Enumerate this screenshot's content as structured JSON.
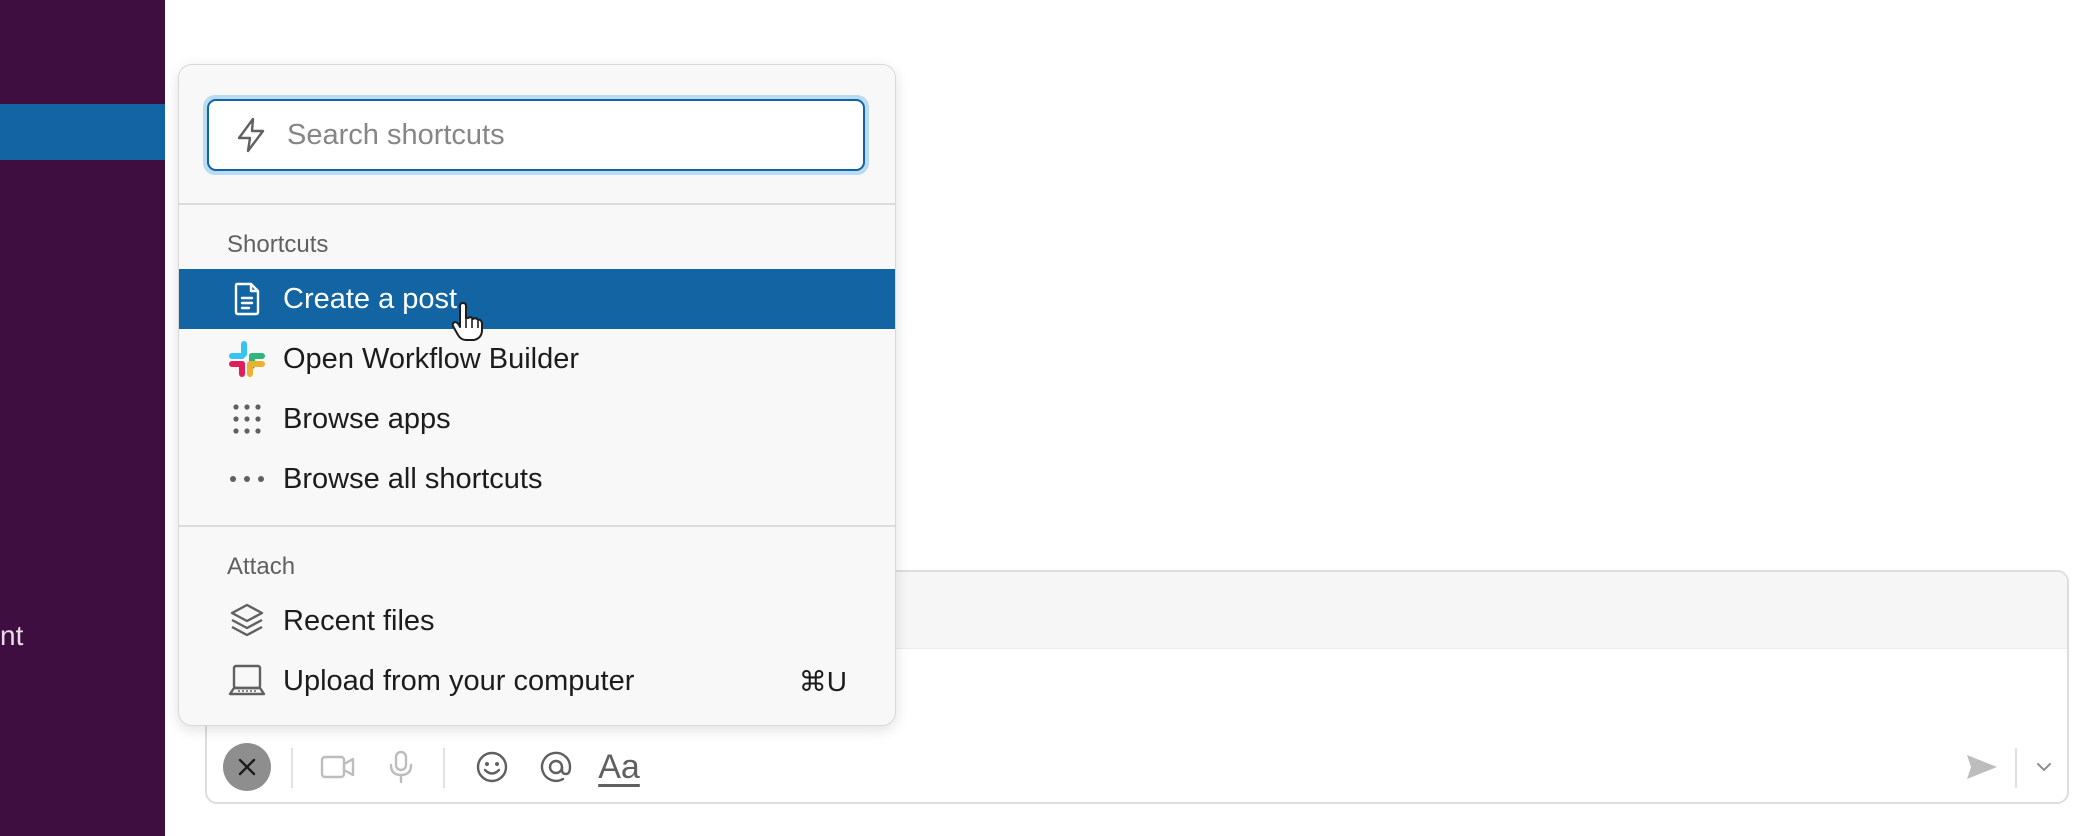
{
  "sidebar": {
    "visible_fragment": "nt"
  },
  "popup": {
    "search": {
      "placeholder": "Search shortcuts",
      "value": ""
    },
    "sections": {
      "shortcuts_label": "Shortcuts",
      "attach_label": "Attach"
    },
    "shortcuts": [
      {
        "label": "Create a post",
        "icon": "document-icon",
        "active": true
      },
      {
        "label": "Open Workflow Builder",
        "icon": "slack-logo-icon"
      },
      {
        "label": "Browse apps",
        "icon": "apps-grid-icon"
      },
      {
        "label": "Browse all shortcuts",
        "icon": "more-horizontal-icon"
      }
    ],
    "attach": [
      {
        "label": "Recent files",
        "icon": "layers-icon"
      },
      {
        "label": "Upload from your computer",
        "icon": "laptop-icon",
        "shortcut": "⌘U"
      }
    ]
  },
  "composer": {
    "toolbar": {
      "format_label": "Aa"
    }
  },
  "colors": {
    "sidebar_bg": "#3f0e40",
    "accent": "#1264a3",
    "focus_ring": "#b9dcf0"
  }
}
